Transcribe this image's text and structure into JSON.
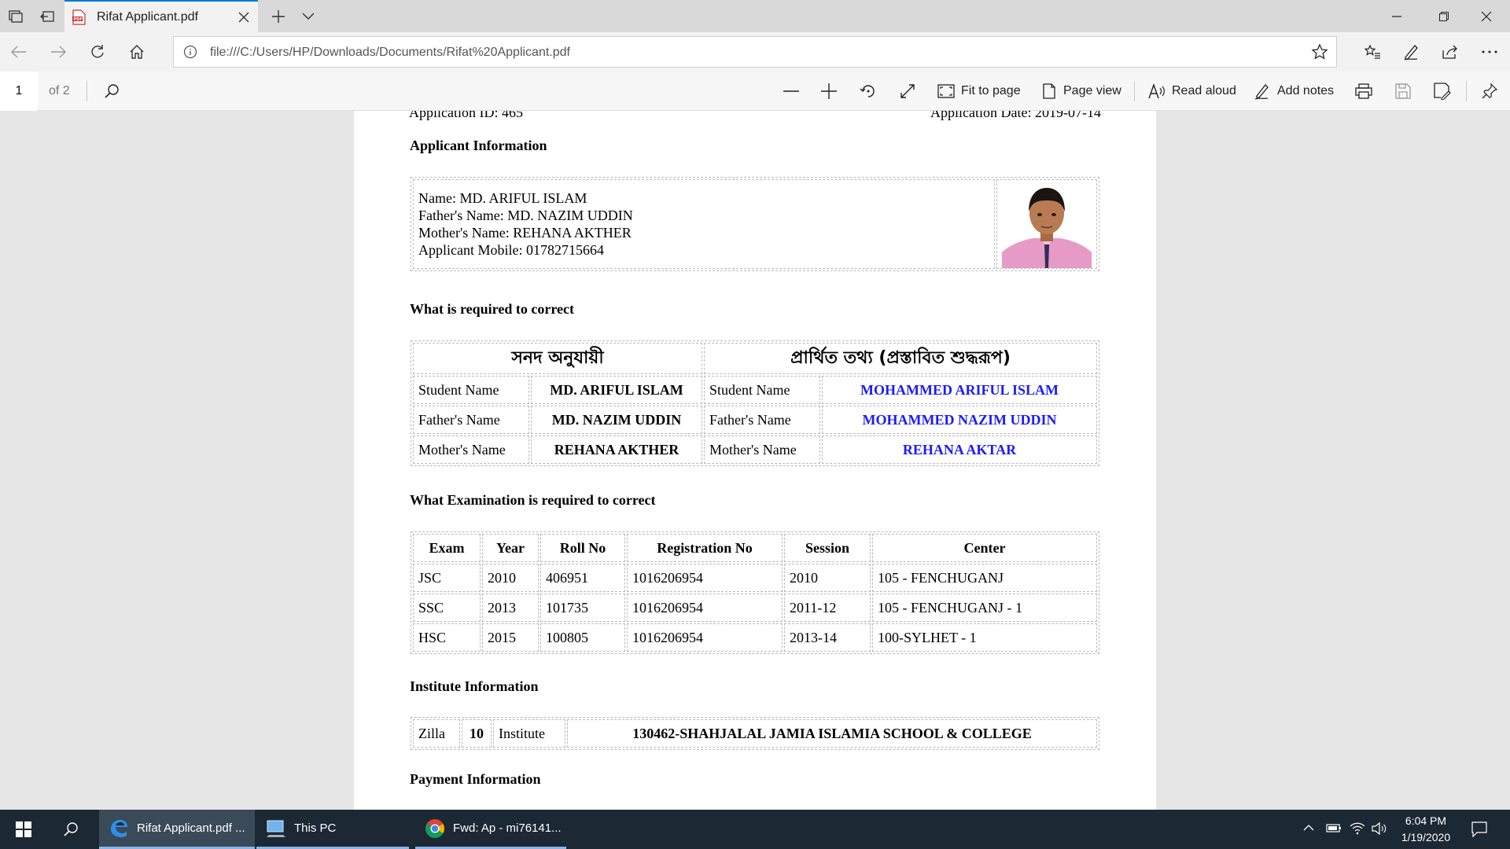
{
  "browser": {
    "tab_title": "Rifat Applicant.pdf",
    "url": "file:///C:/Users/HP/Downloads/Documents/Rifat%20Applicant.pdf"
  },
  "pdf_toolbar": {
    "page_number": "1",
    "page_total": "of 2",
    "fit_to_page": "Fit to page",
    "page_view": "Page view",
    "read_aloud": "Read aloud",
    "add_notes": "Add notes"
  },
  "document": {
    "cut_left": "Application ID: 465",
    "cut_right": "Application Date: 2019-07-14",
    "applicant_heading": "Applicant Information",
    "applicant": {
      "name": "Name: MD. ARIFUL ISLAM",
      "father": "Father's Name: MD. NAZIM UDDIN",
      "mother": "Mother's Name: REHANA AKTHER",
      "mobile": "Applicant Mobile: 01782715664"
    },
    "required_heading": "What is required to correct",
    "required_table": {
      "col_left": "সনদ অনুযায়ী",
      "col_right": "প্রার্থিত তথ্য (প্রস্তাবিত শুদ্ধরূপ)",
      "rows": [
        {
          "label": "Student Name",
          "current": "MD. ARIFUL ISLAM",
          "label2": "Student Name",
          "proposed": "MOHAMMED ARIFUL ISLAM"
        },
        {
          "label": "Father's Name",
          "current": "MD. NAZIM UDDIN",
          "label2": "Father's Name",
          "proposed": "MOHAMMED NAZIM UDDIN"
        },
        {
          "label": "Mother's Name",
          "current": "REHANA AKTHER",
          "label2": "Mother's Name",
          "proposed": "REHANA AKTAR"
        }
      ]
    },
    "exam_heading": "What Examination is required to correct",
    "exam_table": {
      "headers": [
        "Exam",
        "Year",
        "Roll No",
        "Registration No",
        "Session",
        "Center"
      ],
      "rows": [
        [
          "JSC",
          "2010",
          "406951",
          "1016206954",
          "2010",
          "105 - FENCHUGANJ"
        ],
        [
          "SSC",
          "2013",
          "101735",
          "1016206954",
          "2011-12",
          "105 - FENCHUGANJ - 1"
        ],
        [
          "HSC",
          "2015",
          "100805",
          "1016206954",
          "2013-14",
          "100-SYLHET - 1"
        ]
      ]
    },
    "institute_heading": "Institute Information",
    "institute": {
      "zilla_label": "Zilla",
      "zilla_value": "10",
      "institute_label": "Institute",
      "institute_value": "130462-SHAHJALAL JAMIA ISLAMIA SCHOOL & COLLEGE"
    },
    "payment_heading": "Payment Information"
  },
  "taskbar": {
    "items": [
      "Rifat Applicant.pdf ...",
      "This PC",
      "Fwd: Ap - mi76141..."
    ],
    "time": "6:04 PM",
    "date": "1/19/2020"
  },
  "colors": {
    "accent": "#0078d7",
    "proposed_text": "#1a1aff",
    "taskbar": "#1c2833"
  }
}
